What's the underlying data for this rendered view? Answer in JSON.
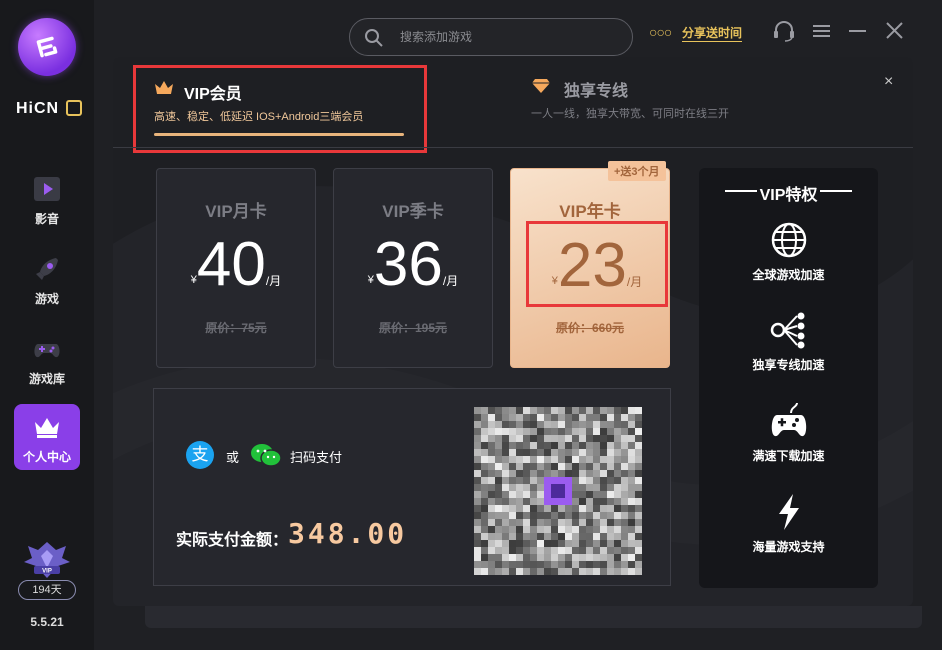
{
  "app": {
    "brand": "HiCN",
    "version": "5.5.21",
    "vip_days": "194天"
  },
  "sidebar": {
    "items": [
      {
        "label": "影音",
        "icon": "play-icon"
      },
      {
        "label": "游戏",
        "icon": "rocket-icon"
      },
      {
        "label": "游戏库",
        "icon": "gamepad-icon"
      },
      {
        "label": "个人中心",
        "icon": "crown-icon"
      }
    ]
  },
  "topbar": {
    "search_placeholder": "搜索添加游戏",
    "share_label": "分享送时间"
  },
  "modal": {
    "tab_vip": {
      "title": "VIP会员",
      "subtitle": "高速、稳定、低延迟 IOS+Android三端会员"
    },
    "tab_exclusive": {
      "title": "独享专线",
      "subtitle": "一人一线，独享大带宽、可同时在线三开"
    },
    "close": "×",
    "plans": [
      {
        "name": "VIP月卡",
        "currency": "¥",
        "price": "40",
        "unit": "/月",
        "original": "原价：75元"
      },
      {
        "name": "VIP季卡",
        "currency": "¥",
        "price": "36",
        "unit": "/月",
        "original": "原价：195元"
      },
      {
        "name": "VIP年卡",
        "currency": "¥",
        "price": "23",
        "unit": "/月",
        "original": "原价：660元"
      }
    ],
    "bonus_badge": "+送3个月",
    "payment": {
      "alipay_glyph": "支",
      "or": "或",
      "scan": "扫码支付",
      "amount_label": "实际支付金额：",
      "amount": "348.00"
    },
    "perks": {
      "title": "VIP特权",
      "items": [
        {
          "label": "全球游戏加速",
          "icon": "globe-icon"
        },
        {
          "label": "独享专线加速",
          "icon": "network-icon"
        },
        {
          "label": "满速下载加速",
          "icon": "controller-icon"
        },
        {
          "label": "海量游戏支持",
          "icon": "lightning-icon"
        }
      ]
    }
  },
  "colors": {
    "accent": "#8a3fe8",
    "gold": "#e8c35c",
    "highlight": "#e8383a",
    "amount": "#f7c9a0"
  }
}
